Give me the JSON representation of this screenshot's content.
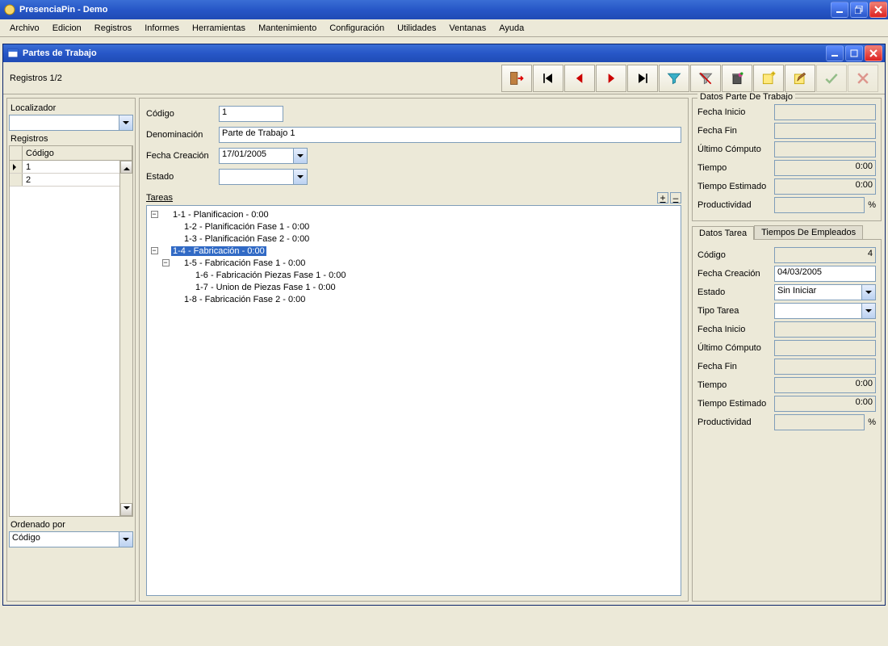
{
  "app": {
    "title": "PresenciaPin - Demo"
  },
  "menu": {
    "items": [
      "Archivo",
      "Edicion",
      "Registros",
      "Informes",
      "Herramientas",
      "Mantenimiento",
      "Configuración",
      "Utilidades",
      "Ventanas",
      "Ayuda"
    ]
  },
  "mdi": {
    "title": "Partes de Trabajo"
  },
  "reg_top": "Registros 1/2",
  "left": {
    "locator_label": "Localizador",
    "locator_value": "",
    "registros_label": "Registros",
    "grid_header": "Código",
    "rows": [
      "1",
      "2"
    ],
    "ordered_by_label": "Ordenado por",
    "ordered_by_value": "Código"
  },
  "center": {
    "codigo_label": "Código",
    "codigo_value": "1",
    "denom_label": "Denominación",
    "denom_value": "Parte de Trabajo 1",
    "fecha_creacion_label": "Fecha Creación",
    "fecha_creacion_value": "17/01/2005",
    "estado_label": "Estado",
    "estado_value": "",
    "tareas_label": "Tareas",
    "plus": "+",
    "minus": "–",
    "tree": [
      {
        "indent": 0,
        "expander": "-",
        "text": "1-1  - Planificacion - 0:00",
        "selected": false
      },
      {
        "indent": 1,
        "expander": "",
        "text": "1-2  - Planificación Fase 1 - 0:00",
        "selected": false
      },
      {
        "indent": 1,
        "expander": "",
        "text": "1-3  - Planificación Fase 2 - 0:00",
        "selected": false
      },
      {
        "indent": 0,
        "expander": "-",
        "text": "1-4  - Fabricación - 0:00",
        "selected": true
      },
      {
        "indent": 1,
        "expander": "-",
        "text": "1-5  - Fabricación Fase 1 - 0:00",
        "selected": false
      },
      {
        "indent": 2,
        "expander": "",
        "text": "1-6  - Fabricación Piezas Fase 1 - 0:00",
        "selected": false
      },
      {
        "indent": 2,
        "expander": "",
        "text": "1-7  - Union de Piezas Fase 1 - 0:00",
        "selected": false
      },
      {
        "indent": 1,
        "expander": "",
        "text": "1-8  - Fabricación Fase 2 - 0:00",
        "selected": false
      }
    ]
  },
  "right": {
    "group_title": "Datos Parte De Trabajo",
    "fecha_inicio_label": "Fecha Inicio",
    "fecha_inicio": "",
    "fecha_fin_label": "Fecha Fin",
    "fecha_fin": "",
    "ultimo_computo_label": "Último Cómputo",
    "ultimo_computo": "",
    "tiempo_label": "Tiempo",
    "tiempo": "0:00",
    "tiempo_est_label": "Tiempo Estimado",
    "tiempo_est": "0:00",
    "productividad_label": "Productividad",
    "productividad": "",
    "pct": "%",
    "tab1": "Datos Tarea",
    "tab2": "Tiempos De Empleados",
    "t_codigo_label": "Código",
    "t_codigo": "4",
    "t_fecha_creacion_label": "Fecha Creación",
    "t_fecha_creacion": "04/03/2005",
    "t_estado_label": "Estado",
    "t_estado": "Sin Iniciar",
    "t_tipo_label": "Tipo Tarea",
    "t_tipo": "",
    "t_fecha_inicio_label": "Fecha Inicio",
    "t_fecha_inicio": "",
    "t_ultimo_label": "Último Cómputo",
    "t_ultimo": "",
    "t_fecha_fin_label": "Fecha Fin",
    "t_fecha_fin": "",
    "t_tiempo_label": "Tiempo",
    "t_tiempo": "0:00",
    "t_tiempo_est_label": "Tiempo Estimado",
    "t_tiempo_est": "0:00",
    "t_prod_label": "Productividad",
    "t_prod": ""
  }
}
